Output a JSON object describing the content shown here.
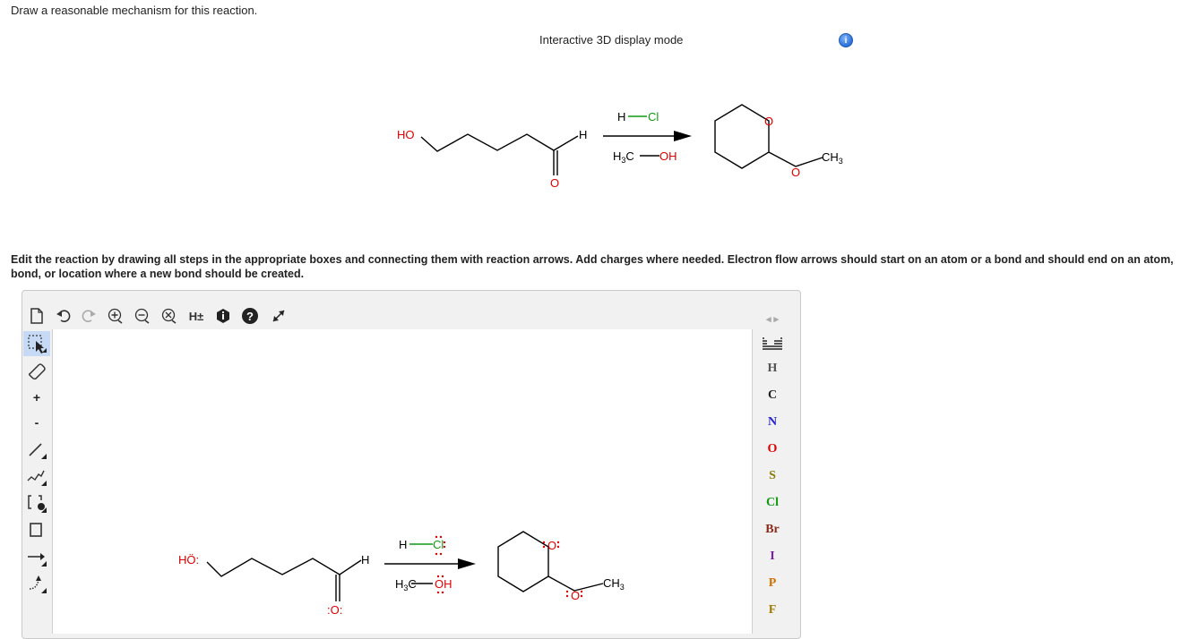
{
  "question": {
    "prompt": "Draw a reasonable mechanism for this reaction."
  },
  "display": {
    "mode_label": "Interactive 3D display mode",
    "info_icon": "info-icon"
  },
  "reaction": {
    "reactant_labels": {
      "hydroxyl": "HO",
      "aldehyde_h": "H",
      "carbonyl_o": "O"
    },
    "reagents": {
      "h": "H",
      "cl": "Cl",
      "h3c": "H",
      "three": "3",
      "c": "C",
      "oh": "OH"
    },
    "product_labels": {
      "ring_o": "O",
      "ether_o": "O",
      "ch3_c": "CH",
      "ch3_3": "3"
    }
  },
  "instructions": "Edit the reaction by drawing all steps in the appropriate boxes and connecting them with reaction arrows. Add charges where needed. Electron flow arrows should start on an atom or a bond and should end on an atom, bond, or location where a new bond should be created.",
  "toolbar": {
    "h_plus_minus": "H±",
    "help": "?",
    "buttons": [
      "new-document-icon",
      "undo-icon",
      "redo-icon",
      "add-positive-charge-icon",
      "add-negative-charge-icon",
      "delete-charge-icon",
      "h-toggle",
      "info-icon",
      "help-icon",
      "expand-icon"
    ]
  },
  "left_tools": [
    "select-lasso-icon",
    "eraser-icon",
    "plus-charge-tool",
    "minus-charge-tool",
    "single-bond-tool",
    "chain-tool",
    "bracket-tool",
    "rectangle-tool",
    "reaction-arrow-tool",
    "curved-arrow-tool"
  ],
  "left_tool_labels": {
    "plus": "+",
    "minus": "-"
  },
  "elements": [
    {
      "symbol": "H",
      "color": "#555555"
    },
    {
      "symbol": "C",
      "color": "#222222"
    },
    {
      "symbol": "N",
      "color": "#2222cc"
    },
    {
      "symbol": "O",
      "color": "#dd0000"
    },
    {
      "symbol": "S",
      "color": "#8a7a00"
    },
    {
      "symbol": "Cl",
      "color": "#119911"
    },
    {
      "symbol": "Br",
      "color": "#8b2a1a"
    },
    {
      "symbol": "I",
      "color": "#7a1fa0"
    },
    {
      "symbol": "P",
      "color": "#d07000"
    },
    {
      "symbol": "F",
      "color": "#a07a00"
    }
  ],
  "canvas_reaction": {
    "reactant_labels": {
      "hydroxyl": "HÖ:",
      "hydroxyl_ho": "HO",
      "aldehyde_h": "H",
      "carbonyl_o": ":O:"
    },
    "reagents": {
      "h": "H",
      "cl": "Cl",
      "h3c": "H",
      "three": "3",
      "c": "C",
      "oh": "OH"
    },
    "product_labels": {
      "ring_o": "O",
      "ether_o": "O",
      "ch3_c": "CH",
      "ch3_3": "3"
    }
  },
  "colors": {
    "oxygen": "#dd0000",
    "chlorine": "#119911",
    "selection": "#c7daf5"
  }
}
